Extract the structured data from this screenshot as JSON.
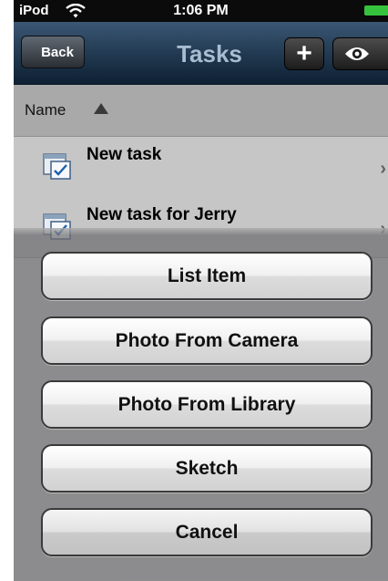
{
  "status_bar": {
    "carrier": "iPod",
    "time": "1:06 PM"
  },
  "navbar": {
    "back_label": "Back",
    "title": "Tasks",
    "add_label": "+",
    "eye_icon": "eye-icon"
  },
  "list_header": {
    "sort_label": "Name"
  },
  "tasks": [
    {
      "title": "New task"
    },
    {
      "title": "New task for Jerry"
    }
  ],
  "action_sheet": {
    "buttons": [
      "List Item",
      "Photo From Camera",
      "Photo From Library",
      "Sketch"
    ],
    "cancel_label": "Cancel"
  },
  "colors": {
    "battery": "#36c23d",
    "navbar": "#20384f",
    "title": "#a9bdd1"
  }
}
